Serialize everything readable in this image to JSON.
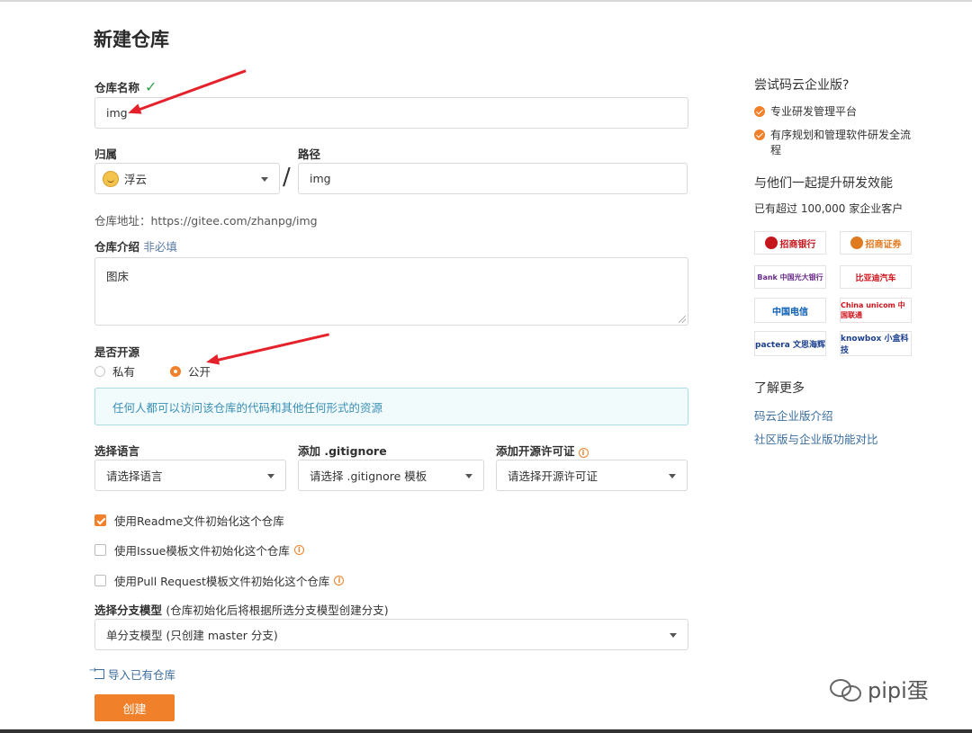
{
  "page_title": "新建仓库",
  "repo_name": {
    "label": "仓库名称",
    "value": "img"
  },
  "owner": {
    "label": "归属",
    "value": "浮云"
  },
  "path": {
    "label": "路径",
    "value": "img"
  },
  "repo_url": "仓库地址：https://gitee.com/zhanpg/img",
  "description": {
    "label": "仓库介绍",
    "hint": "非必填",
    "value": "图床"
  },
  "visibility": {
    "label": "是否开源",
    "private_label": "私有",
    "public_label": "公开",
    "selected": "public",
    "notice": "任何人都可以访问该仓库的代码和其他任何形式的资源"
  },
  "language": {
    "label": "选择语言",
    "value": "请选择语言"
  },
  "gitignore": {
    "label": "添加 .gitignore",
    "value": "请选择 .gitignore 模板"
  },
  "license": {
    "label": "添加开源许可证",
    "value": "请选择开源许可证"
  },
  "checkboxes": [
    {
      "label": "使用Readme文件初始化这个仓库",
      "checked": true,
      "info": false
    },
    {
      "label": "使用Issue模板文件初始化这个仓库",
      "checked": false,
      "info": true
    },
    {
      "label": "使用Pull Request模板文件初始化这个仓库",
      "checked": false,
      "info": true
    }
  ],
  "branch_model": {
    "label": "选择分支模型",
    "hint": "(仓库初始化后将根据所选分支模型创建分支)",
    "value": "单分支模型 (只创建 master 分支)"
  },
  "import_link": "导入已有仓库",
  "create_button": "创建",
  "sidebar": {
    "promo_title": "尝试码云企业版?",
    "features": [
      "专业研发管理平台",
      "有序规划和管理软件研发全流程"
    ],
    "customers_title": "与他们一起提升研发效能",
    "customers_sub": "已有超过 100,000 家企业客户",
    "logos": [
      "招商银行",
      "招商证券",
      "Bank 中国光大银行",
      "比亚迪汽车",
      "中国电信",
      "China unicom 中国联通",
      "pactera 文思海辉",
      "knowbox 小盒科技"
    ],
    "learn_title": "了解更多",
    "links": [
      "码云企业版介绍",
      "社区版与企业版功能对比"
    ]
  },
  "watermark": "pipi蛋",
  "colors": {
    "accent": "#f0812a",
    "link": "#3b6e9e",
    "notice_text": "#3a8fb7",
    "annotation_arrow": "#e5222b"
  }
}
